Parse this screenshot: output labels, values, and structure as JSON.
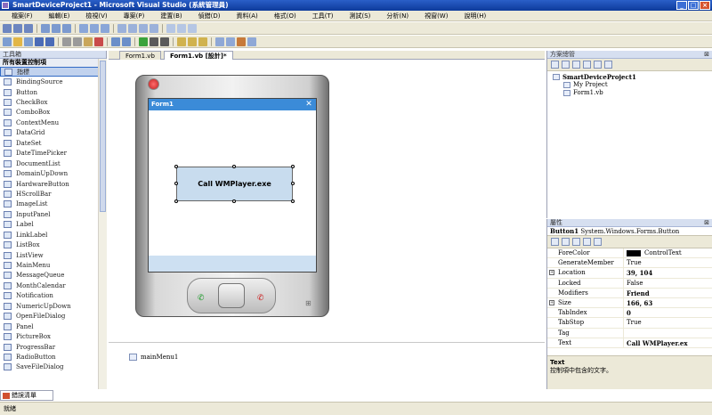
{
  "window": {
    "title": "SmartDeviceProject1 - Microsoft Visual Studio (系統管理員)"
  },
  "menu": [
    "檔案(F)",
    "編輯(E)",
    "檢視(V)",
    "專案(P)",
    "建置(B)",
    "偵錯(D)",
    "資料(A)",
    "格式(O)",
    "工具(T)",
    "測試(S)",
    "分析(N)",
    "視窗(W)",
    "說明(H)"
  ],
  "toolbox": {
    "title": "工具箱",
    "category": "所有裝置控制項",
    "items": [
      "指標",
      "BindingSource",
      "Button",
      "CheckBox",
      "ComboBox",
      "ContextMenu",
      "DataGrid",
      "DateSet",
      "DateTimePicker",
      "DocumentList",
      "DomainUpDown",
      "HardwareButton",
      "HScrollBar",
      "ImageList",
      "InputPanel",
      "Label",
      "LinkLabel",
      "ListBox",
      "ListView",
      "MainMenu",
      "MessageQueue",
      "MonthCalendar",
      "Notification",
      "NumericUpDown",
      "OpenFileDialog",
      "Panel",
      "PictureBox",
      "ProgressBar",
      "RadioButton",
      "SaveFileDialog"
    ],
    "selected_index": 0
  },
  "tabs": [
    "Form1.vb",
    "Form1.vb [設計]*"
  ],
  "designer": {
    "form_title": "Form1",
    "form_close": "✕",
    "button_text": "Call WMPlayer.exe",
    "tray_component": "mainMenu1"
  },
  "solution": {
    "title": "方案總管",
    "nodes": [
      "SmartDeviceProject1",
      "My Project",
      "Form1.vb"
    ]
  },
  "properties": {
    "title": "屬性",
    "object": "Button1",
    "object_type": "System.Windows.Forms.Button",
    "rows": [
      {
        "name": "ForeColor",
        "value": "ControlText",
        "swatch": true,
        "bold": false,
        "expandable": false
      },
      {
        "name": "GenerateMember",
        "value": "True",
        "swatch": false,
        "bold": false,
        "expandable": false
      },
      {
        "name": "Location",
        "value": "39, 104",
        "swatch": false,
        "bold": true,
        "expandable": true
      },
      {
        "name": "Locked",
        "value": "False",
        "swatch": false,
        "bold": false,
        "expandable": false
      },
      {
        "name": "Modifiers",
        "value": "Friend",
        "swatch": false,
        "bold": true,
        "expandable": false
      },
      {
        "name": "Size",
        "value": "166, 63",
        "swatch": false,
        "bold": true,
        "expandable": true
      },
      {
        "name": "TabIndex",
        "value": "0",
        "swatch": false,
        "bold": true,
        "expandable": false
      },
      {
        "name": "TabStop",
        "value": "True",
        "swatch": false,
        "bold": false,
        "expandable": false
      },
      {
        "name": "Tag",
        "value": "",
        "swatch": false,
        "bold": false,
        "expandable": false
      },
      {
        "name": "Text",
        "value": "Call WMPlayer.ex",
        "swatch": false,
        "bold": true,
        "expandable": false
      }
    ],
    "desc_title": "Text",
    "desc_text": "控制項中包含的文字。"
  },
  "output_tab": "錯誤清單",
  "status": "就緒"
}
